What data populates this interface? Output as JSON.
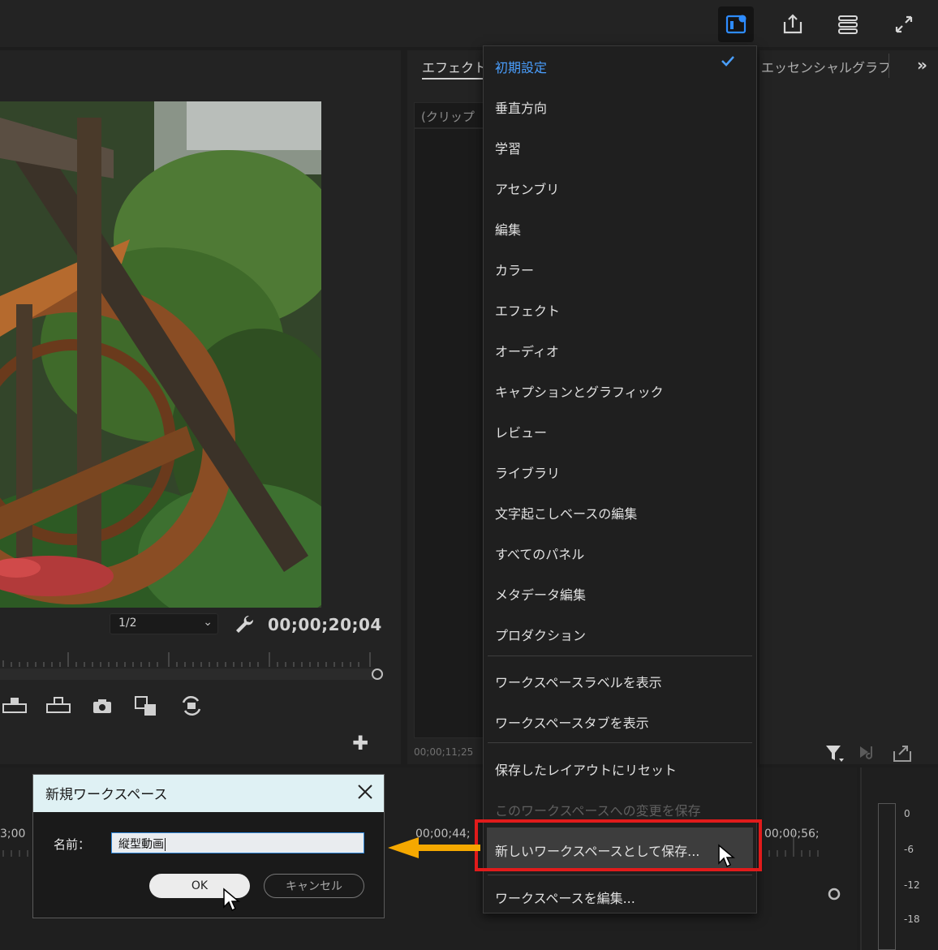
{
  "program_monitor": {
    "resolution_value": "1/2",
    "timecode": "00;00;20;04"
  },
  "effect_controls": {
    "tab_label": "エフェクト",
    "clip_label": "(クリップ",
    "timecode": "00;00;11;25"
  },
  "essential_graphics": {
    "tab_label": "エッセンシャルグラフ",
    "more_label": "»"
  },
  "workspace_menu": {
    "selected_item": "初期設定",
    "items": [
      "初期設定",
      "垂直方向",
      "学習",
      "アセンブリ",
      "編集",
      "カラー",
      "エフェクト",
      "オーディオ",
      "キャプションとグラフィック",
      "レビュー",
      "ライブラリ",
      "文字起こしベースの編集",
      "すべてのパネル",
      "メタデータ編集",
      "プロダクション"
    ],
    "show_label": "ワークスペースラベルを表示",
    "show_tabs": "ワークスペースタブを表示",
    "reset": "保存したレイアウトにリセット",
    "save_changes": "このワークスペースへの変更を保存",
    "save_as_new": "新しいワークスペースとして保存...",
    "edit": "ワークスペースを編集..."
  },
  "dialog": {
    "title": "新規ワークスペース",
    "name_label": "名前：",
    "name_value": "縦型動画",
    "ok_label": "OK",
    "cancel_label": "キャンセル"
  },
  "timeline": {
    "tc_left": "3;00",
    "tc_mid": "00;00;44;",
    "tc_right": "00;00;56;"
  },
  "audio_meter": {
    "labels": [
      "0",
      "-6",
      "-12",
      "-18"
    ]
  },
  "colors": {
    "accent_blue": "#4a9fff",
    "highlight_red": "#e11b1b",
    "arrow_orange": "#f5a800",
    "dialog_titlebar": "#dff1f4"
  }
}
